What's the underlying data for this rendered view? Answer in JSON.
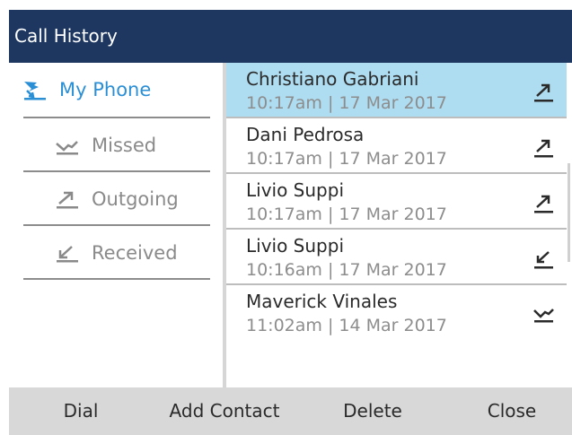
{
  "title": "Call History",
  "sidebar": {
    "items": [
      {
        "label": "My Phone",
        "icon": "phone-calls-icon"
      },
      {
        "label": "Missed",
        "icon": "missed-call-icon"
      },
      {
        "label": "Outgoing",
        "icon": "outgoing-call-icon"
      },
      {
        "label": "Received",
        "icon": "received-call-icon"
      }
    ]
  },
  "calls": [
    {
      "name": "Christiano Gabriani",
      "time": "10:17am",
      "sep": "|",
      "date": "17 Mar 2017",
      "type": "outgoing"
    },
    {
      "name": "Dani Pedrosa",
      "time": "10:17am",
      "sep": "|",
      "date": "17 Mar 2017",
      "type": "outgoing"
    },
    {
      "name": "Livio Suppi",
      "time": "10:17am",
      "sep": "|",
      "date": "17 Mar 2017",
      "type": "outgoing"
    },
    {
      "name": "Livio Suppi",
      "time": "10:16am",
      "sep": "|",
      "date": "17 Mar 2017",
      "type": "received"
    },
    {
      "name": "Maverick Vinales",
      "time": "11:02am",
      "sep": "|",
      "date": "14 Mar 2017",
      "type": "missed"
    }
  ],
  "softkeys": {
    "dial": "Dial",
    "add_contact": "Add Contact",
    "delete": "Delete",
    "close": "Close"
  },
  "colors": {
    "titlebar": "#1d3761",
    "selected_row": "#aedcf0",
    "active_accent": "#2b8fd6",
    "softkey_bar": "#d8d8d8"
  }
}
